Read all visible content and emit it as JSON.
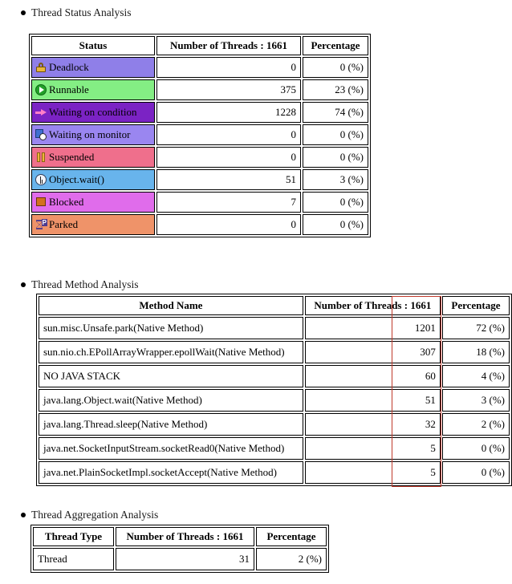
{
  "sections": {
    "status": {
      "heading": "Thread Status Analysis"
    },
    "method": {
      "heading": "Thread Method Analysis"
    },
    "aggregation": {
      "heading": "Thread Aggregation Analysis"
    }
  },
  "status_table": {
    "columns": [
      "Status",
      "Number of Threads : 1661",
      "Percentage"
    ],
    "rows": [
      {
        "icon": "lock-icon",
        "label": "Deadlock",
        "threads": "0",
        "percentage": "0 (%)",
        "bg": "#8f7fe8"
      },
      {
        "icon": "play-icon",
        "label": "Runnable",
        "threads": "375",
        "percentage": "23 (%)",
        "bg": "#84ee84"
      },
      {
        "icon": "arrow-icon",
        "label": "Waiting on condition",
        "threads": "1228",
        "percentage": "74 (%)",
        "bg": "#7b23c4"
      },
      {
        "icon": "doc-clock-icon",
        "label": "Waiting on monitor",
        "threads": "0",
        "percentage": "0 (%)",
        "bg": "#9a86f0"
      },
      {
        "icon": "pause-icon",
        "label": "Suspended",
        "threads": "0",
        "percentage": "0 (%)",
        "bg": "#ef6f8c"
      },
      {
        "icon": "clock-icon",
        "label": "Object.wait()",
        "threads": "51",
        "percentage": "3 (%)",
        "bg": "#68b4ec"
      },
      {
        "icon": "square-icon",
        "label": "Blocked",
        "threads": "7",
        "percentage": "0 (%)",
        "bg": "#e06ceb"
      },
      {
        "icon": "hourglass-icon",
        "label": "Parked",
        "threads": "0",
        "percentage": "0 (%)",
        "bg": "#ef9369"
      }
    ]
  },
  "method_table": {
    "columns": [
      "Method Name",
      "Number of Threads : 1661",
      "Percentage"
    ],
    "rows": [
      {
        "method": "sun.misc.Unsafe.park(Native Method)",
        "threads": "1201",
        "percentage": "72 (%)"
      },
      {
        "method": "sun.nio.ch.EPollArrayWrapper.epollWait(Native Method)",
        "threads": "307",
        "percentage": "18 (%)"
      },
      {
        "method": "NO JAVA STACK",
        "threads": "60",
        "percentage": "4 (%)"
      },
      {
        "method": "java.lang.Object.wait(Native Method)",
        "threads": "51",
        "percentage": "3 (%)"
      },
      {
        "method": "java.lang.Thread.sleep(Native Method)",
        "threads": "32",
        "percentage": "2 (%)"
      },
      {
        "method": "java.net.SocketInputStream.socketRead0(Native Method)",
        "threads": "5",
        "percentage": "0 (%)"
      },
      {
        "method": "java.net.PlainSocketImpl.socketAccept(Native Method)",
        "threads": "5",
        "percentage": "0 (%)"
      }
    ]
  },
  "aggregation_table": {
    "columns": [
      "Thread Type",
      "Number of Threads : 1661",
      "Percentage"
    ],
    "rows": [
      {
        "type": "Thread",
        "threads": "31",
        "percentage": "2 (%)"
      }
    ]
  },
  "annotation": {
    "color": "#c0392b",
    "target": "Number of Threads : 1661 column of Thread Method Analysis"
  },
  "totals": {
    "thread_count": "1661"
  }
}
